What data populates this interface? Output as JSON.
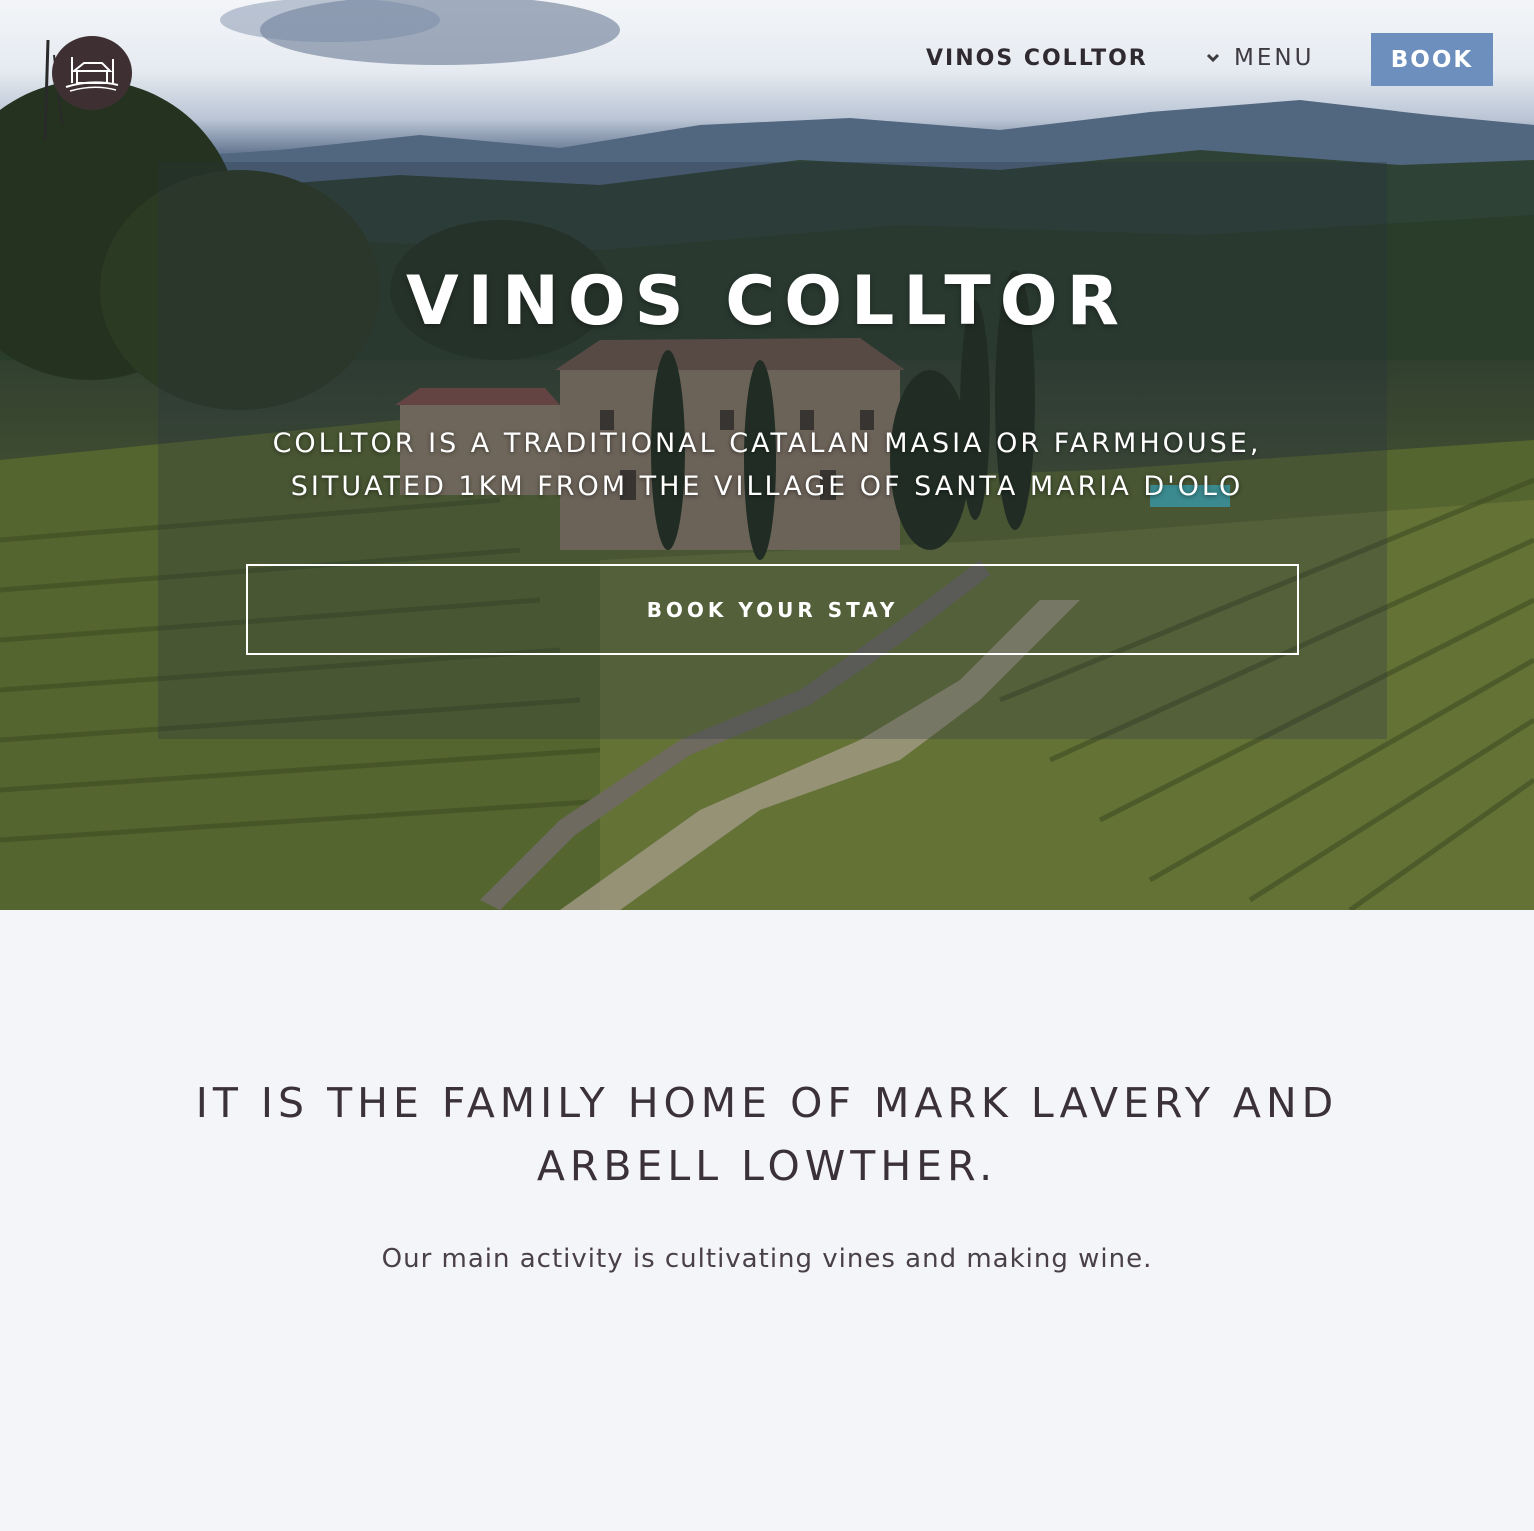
{
  "header": {
    "brand": "VINOS COLLTOR",
    "menu_label": "MENU",
    "book_label": "BOOK"
  },
  "hero": {
    "title": "VINOS COLLTOR",
    "subtitle_line1": "COLLTOR IS A TRADITIONAL CATALAN MASIA OR FARMHOUSE,",
    "subtitle_line2": "SITUATED 1KM FROM THE VILLAGE OF SANTA MARIA D'OLO",
    "cta_label": "BOOK YOUR STAY"
  },
  "intro": {
    "heading_line1": "IT IS THE FAMILY HOME OF MARK LAVERY AND",
    "heading_line2": "ARBELL LOWTHER.",
    "text": "Our main activity is cultivating vines and making wine."
  },
  "colors": {
    "book_button": "#6d8fbd",
    "page_background": "#f4f5f9",
    "logo_background": "#3e2f33",
    "text_dark": "#3b3138"
  }
}
